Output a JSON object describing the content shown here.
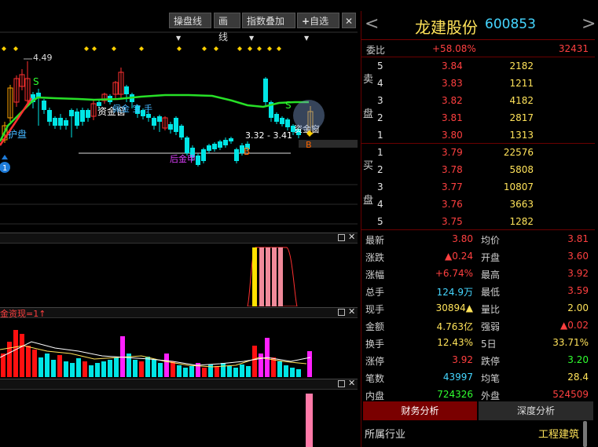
{
  "toolbar": {
    "btn1": "操盘线",
    "btn2": "画线",
    "btn3": "指数叠加",
    "btn4": "自选",
    "plus": "+",
    "close": "✕"
  },
  "chart": {
    "high_label": "4.49",
    "range_label": "3.32 - 3.41",
    "signal_b": "B",
    "signal_s": "S",
    "circle_num": "1",
    "txt_hupan": "护盘",
    "txt_ziyin": "资金窗",
    "txt_peitian": "佩金 宝 手",
    "txt_houjin": "后金甲",
    "txt_zhijin": "资金窗",
    "diamonds_count": 10
  },
  "panel3": {
    "label": "金资现=1↑"
  },
  "quote": {
    "name": "龙建股份",
    "code": "600853",
    "nav_left": "<",
    "nav_right": ">",
    "weibi_label": "委比",
    "weibi_pct": "+58.08%",
    "weibi_val": "32431",
    "sell_label": "卖盘",
    "sell_char1": "卖",
    "sell_char2": "盘",
    "sells": [
      {
        "level": "5",
        "price": "3.84",
        "vol": "2182"
      },
      {
        "level": "4",
        "price": "3.83",
        "vol": "1211"
      },
      {
        "level": "3",
        "price": "3.82",
        "vol": "4182"
      },
      {
        "level": "2",
        "price": "3.81",
        "vol": "2817"
      },
      {
        "level": "1",
        "price": "3.80",
        "vol": "1313"
      }
    ],
    "buy_char1": "买",
    "buy_char2": "盘",
    "buys": [
      {
        "level": "1",
        "price": "3.79",
        "vol": "22576"
      },
      {
        "level": "2",
        "price": "3.78",
        "vol": "5808"
      },
      {
        "level": "3",
        "price": "3.77",
        "vol": "10807"
      },
      {
        "level": "4",
        "price": "3.76",
        "vol": "3663"
      },
      {
        "level": "5",
        "price": "3.75",
        "vol": "1282"
      }
    ],
    "stats": [
      {
        "l1": "最新",
        "v1": "3.80",
        "c1": "red",
        "l2": "均价",
        "v2": "3.81",
        "c2": "red"
      },
      {
        "l1": "涨跌",
        "v1": "▲0.24",
        "c1": "red",
        "l2": "开盘",
        "v2": "3.60",
        "c2": "red"
      },
      {
        "l1": "涨幅",
        "v1": "+6.74%",
        "c1": "red",
        "l2": "最高",
        "v2": "3.92",
        "c2": "red"
      },
      {
        "l1": "总手",
        "v1": "124.9万",
        "c1": "cyan",
        "l2": "最低",
        "v2": "3.59",
        "c2": "red"
      },
      {
        "l1": "现手",
        "v1": "30894▲",
        "c1": "yellow",
        "l2": "量比",
        "v2": "2.00",
        "c2": "yellow"
      },
      {
        "l1": "金额",
        "v1": "4.763亿",
        "c1": "yellow",
        "l2": "强弱",
        "v2": "▲0.02",
        "c2": "red"
      },
      {
        "l1": "换手",
        "v1": "12.43%",
        "c1": "yellow",
        "l2": "5日",
        "v2": "33.71%",
        "c2": "yellow"
      },
      {
        "l1": "涨停",
        "v1": "3.92",
        "c1": "red",
        "l2": "跌停",
        "v2": "3.20",
        "c2": "green"
      },
      {
        "l1": "笔数",
        "v1": "43997",
        "c1": "cyan",
        "l2": "均笔",
        "v2": "28.4",
        "c2": "yellow"
      },
      {
        "l1": "内盘",
        "v1": "724326",
        "c1": "green",
        "l2": "外盘",
        "v2": "524509",
        "c2": "red"
      }
    ],
    "tab1": "财务分析",
    "tab2": "深度分析",
    "industry_label": "所属行业",
    "industry_value": "工程建筑"
  },
  "colors": {
    "up": "#ff3030",
    "down": "#00e5e5",
    "ma": "#27e027",
    "bg": "#000000"
  }
}
